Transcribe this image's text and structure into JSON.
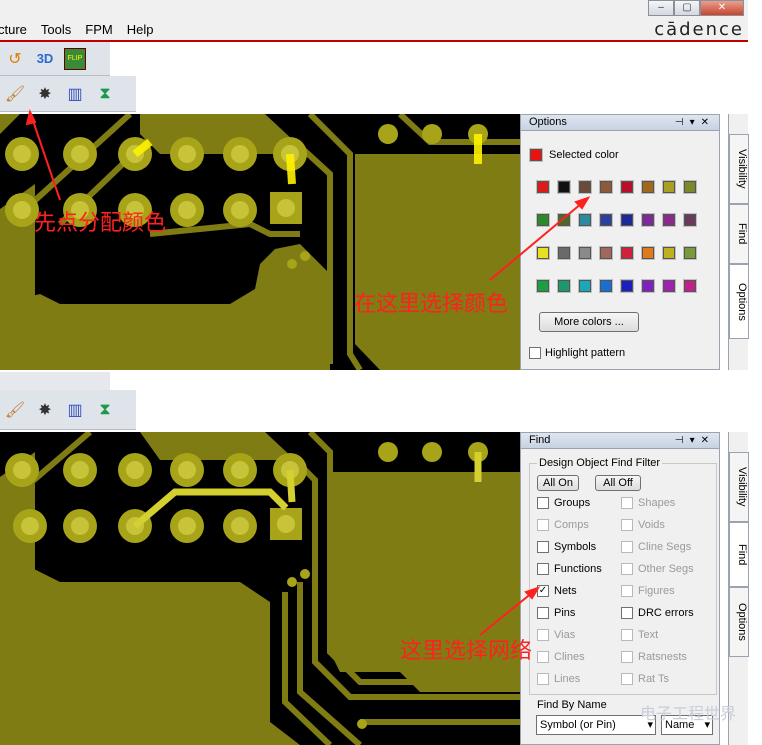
{
  "window": {
    "btn_min": "–",
    "btn_max": "▢",
    "btn_close": "✕"
  },
  "menu": {
    "items": [
      "cture",
      "Tools",
      "FPM",
      "Help"
    ]
  },
  "brand": "cādence",
  "toolbar": {
    "icons": [
      "undo-icon",
      "3d-view-icon",
      "flip-icon",
      "brush-icon",
      "bomb-icon",
      "color-bars-icon",
      "hourglass-icon"
    ],
    "label_3d": "3D",
    "label_flip": "FLIP"
  },
  "options_panel": {
    "title": "Options",
    "selected_color_label": "Selected color",
    "selected_color": "#ee1111",
    "palette": [
      [
        "#dd1a1a",
        "#111111",
        "#6b4a3a",
        "#8a5a3a",
        "#b8102a",
        "#a0681a",
        "#a8a020",
        "#7a8a2a"
      ],
      [
        "#2a8a2a",
        "#4a6a2a",
        "#2a8aa0",
        "#2a40a0",
        "#1a2a9a",
        "#7a2a9a",
        "#8a2a8a",
        "#6a3a5a"
      ],
      [
        "#e8e020",
        "#6a6a6a",
        "#8a8a8a",
        "#a0685a",
        "#d0203a",
        "#e07a1a",
        "#c0b020",
        "#7a9a3a"
      ],
      [
        "#1aa040",
        "#1a9a6a",
        "#1aa8b8",
        "#1a70d0",
        "#1a20c0",
        "#8020c0",
        "#a020b0",
        "#c0208a"
      ]
    ],
    "more_colors": "More colors ...",
    "highlight_pattern": "Highlight pattern"
  },
  "find_panel": {
    "title": "Find",
    "group_title": "Design Object Find Filter",
    "all_on": "All On",
    "all_off": "All Off",
    "left_items": [
      {
        "label": "Groups",
        "checked": false,
        "enabled": true
      },
      {
        "label": "Comps",
        "checked": false,
        "enabled": false
      },
      {
        "label": "Symbols",
        "checked": false,
        "enabled": true
      },
      {
        "label": "Functions",
        "checked": false,
        "enabled": true
      },
      {
        "label": "Nets",
        "checked": true,
        "enabled": true
      },
      {
        "label": "Pins",
        "checked": false,
        "enabled": true
      },
      {
        "label": "Vias",
        "checked": false,
        "enabled": false
      },
      {
        "label": "Clines",
        "checked": false,
        "enabled": false
      },
      {
        "label": "Lines",
        "checked": false,
        "enabled": false
      }
    ],
    "right_items": [
      {
        "label": "Shapes",
        "checked": false,
        "enabled": false
      },
      {
        "label": "Voids",
        "checked": false,
        "enabled": false
      },
      {
        "label": "Cline Segs",
        "checked": false,
        "enabled": false
      },
      {
        "label": "Other Segs",
        "checked": false,
        "enabled": false
      },
      {
        "label": "Figures",
        "checked": false,
        "enabled": false
      },
      {
        "label": "DRC errors",
        "checked": false,
        "enabled": true
      },
      {
        "label": "Text",
        "checked": false,
        "enabled": false
      },
      {
        "label": "Ratsnests",
        "checked": false,
        "enabled": false
      },
      {
        "label": "Rat Ts",
        "checked": false,
        "enabled": false
      }
    ],
    "find_by_name": "Find By Name",
    "symbol_select": "Symbol (or Pin)",
    "name_select": "Name"
  },
  "side_tabs": [
    "Visibility",
    "Find",
    "Options"
  ],
  "annotations": {
    "top_left": "先点分配颜色",
    "top_right": "在这里选择颜色",
    "bottom": "这里选择网络"
  },
  "watermark": "电子工程世界"
}
